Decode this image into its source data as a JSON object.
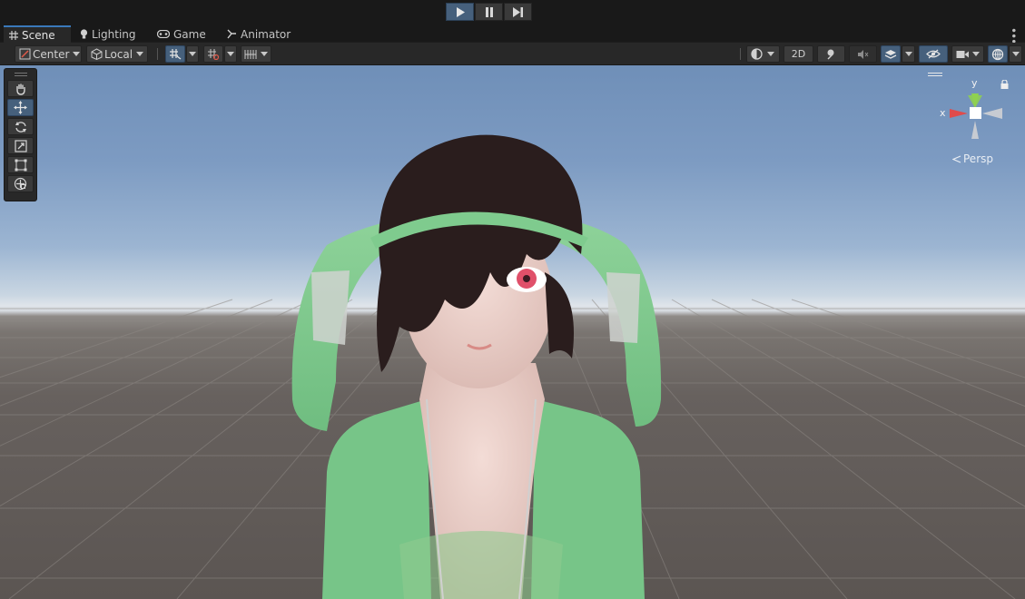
{
  "playbar": {
    "play_icon": "play-icon",
    "pause_icon": "pause-icon",
    "step_icon": "step-icon"
  },
  "tabs": [
    {
      "label": "Scene",
      "icon": "grid-icon",
      "active": true
    },
    {
      "label": "Lighting",
      "icon": "bulb-icon",
      "active": false
    },
    {
      "label": "Game",
      "icon": "gamepad-icon",
      "active": false
    },
    {
      "label": "Animator",
      "icon": "animator-icon",
      "active": false
    }
  ],
  "toolbar": {
    "pivot_label": "Center",
    "space_label": "Local",
    "mode_2d_label": "2D"
  },
  "viewport": {
    "projection_label": "Persp",
    "gizmo_x_label": "x",
    "gizmo_y_label": "y"
  },
  "colors": {
    "accent": "#46607c",
    "tab_highlight": "#3a79bb",
    "gizmo_x": "#e04b4b",
    "gizmo_y": "#8fd14f",
    "hoodie": "#7cc78a",
    "hair": "#2a1d1d"
  }
}
